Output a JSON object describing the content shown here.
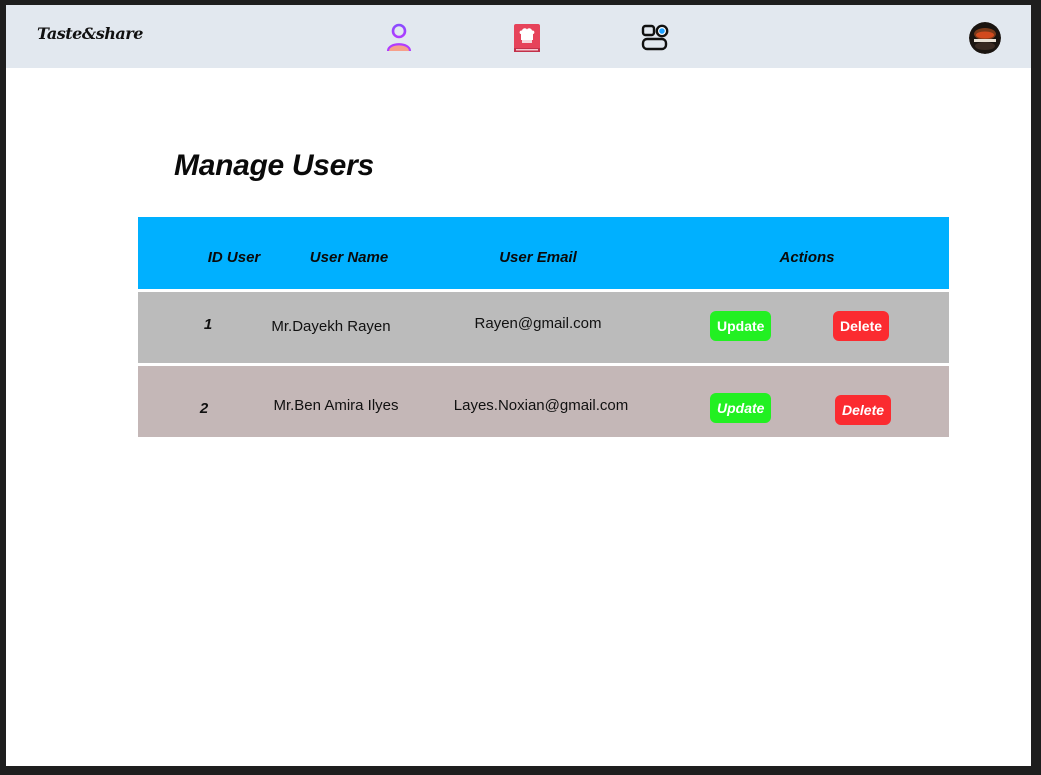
{
  "navbar": {
    "brand": "Taste&share",
    "icons": [
      "user-profile-icon",
      "recipe-book-icon",
      "dashboard-icon"
    ],
    "avatar": "user-avatar"
  },
  "main": {
    "title": "Manage Users"
  },
  "table": {
    "headers": {
      "id": "ID User",
      "name": "User Name",
      "email": "User Email",
      "actions": "Actions"
    },
    "rows": [
      {
        "id": "1",
        "name": "Mr.Dayekh Rayen",
        "email": "Rayen@gmail.com",
        "update_label": "Update",
        "delete_label": "Delete"
      },
      {
        "id": "2",
        "name": "Mr.Ben Amira Ilyes",
        "email": "Layes.Noxian@gmail.com",
        "update_label": "Update",
        "delete_label": "Delete"
      }
    ]
  },
  "colors": {
    "navbar_bg": "#e2e8ef",
    "header_bg": "#00b0ff",
    "row_1_bg": "#bbbbbb",
    "row_2_bg": "#c4b7b7",
    "update_btn": "#22f022",
    "delete_btn": "#fb2b30"
  }
}
